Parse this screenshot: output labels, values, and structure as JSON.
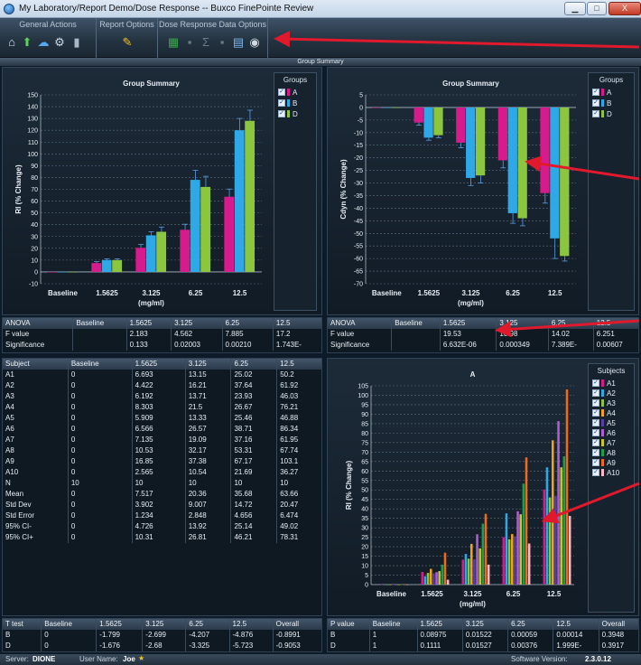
{
  "window": {
    "title": "My Laboratory/Report Demo/Dose Response -- Buxco FinePointe Review",
    "minimize": "▁",
    "maximize": "□",
    "close": "X"
  },
  "ribbon": {
    "groups": [
      {
        "label": "General Actions"
      },
      {
        "label": "Report Options"
      },
      {
        "label": "Dose Response Data Options"
      }
    ]
  },
  "panel_header": "Group Summary",
  "colors": {
    "A": "#d81b8c",
    "B": "#2ea8e6",
    "D": "#8cc63f",
    "arrow": "#e0192c"
  },
  "chart_data": [
    {
      "type": "bar",
      "title": "Group Summary",
      "xlabel": "(mg/ml)",
      "ylabel": "RI (% Change)",
      "categories": [
        "Baseline",
        "1.5625",
        "3.125",
        "6.25",
        "12.5"
      ],
      "ylim": [
        -10,
        150
      ],
      "ytick_step": 10,
      "legend_title": "Groups",
      "series": [
        {
          "name": "A",
          "values": [
            0,
            7.5,
            20.4,
            35.7,
            63.7
          ],
          "err": [
            0,
            1.2,
            2.8,
            4.7,
            6.5
          ]
        },
        {
          "name": "B",
          "values": [
            0,
            10,
            31,
            78,
            120
          ],
          "err": [
            0,
            1,
            3,
            8,
            10
          ]
        },
        {
          "name": "D",
          "values": [
            0,
            10,
            34,
            72,
            128
          ],
          "err": [
            0,
            1,
            4,
            9,
            9
          ]
        }
      ]
    },
    {
      "type": "bar",
      "title": "Group Summary",
      "xlabel": "(mg/ml)",
      "ylabel": "Cdyn (% Change)",
      "categories": [
        "Baseline",
        "1.5625",
        "3.125",
        "6.25",
        "12.5"
      ],
      "ylim": [
        -70,
        5
      ],
      "ytick_step": 5,
      "legend_title": "Groups",
      "series": [
        {
          "name": "A",
          "values": [
            0,
            -6,
            -14,
            -21,
            -34
          ],
          "err": [
            0,
            1,
            2,
            3,
            4
          ]
        },
        {
          "name": "B",
          "values": [
            0,
            -12,
            -28,
            -42,
            -52
          ],
          "err": [
            0,
            1,
            3,
            4,
            8
          ]
        },
        {
          "name": "D",
          "values": [
            0,
            -11,
            -27,
            -44,
            -59
          ],
          "err": [
            0,
            1,
            3,
            3,
            2
          ]
        }
      ]
    },
    {
      "type": "bar",
      "title": "A",
      "xlabel": "(mg/ml)",
      "ylabel": "RI (% Change)",
      "categories": [
        "Baseline",
        "1.5625",
        "3.125",
        "6.25",
        "12.5"
      ],
      "ylim": [
        0,
        105
      ],
      "ytick_step": 5,
      "legend_title": "Subjects",
      "series": [
        {
          "name": "A1",
          "values": [
            0,
            6.693,
            13.15,
            25.02,
            50.2
          ]
        },
        {
          "name": "A2",
          "values": [
            0,
            4.422,
            16.21,
            37.64,
            61.92
          ]
        },
        {
          "name": "A3",
          "values": [
            0,
            6.192,
            13.71,
            23.93,
            46.03
          ]
        },
        {
          "name": "A4",
          "values": [
            0,
            8.303,
            21.5,
            26.67,
            76.21
          ]
        },
        {
          "name": "A5",
          "values": [
            0,
            5.909,
            13.33,
            25.46,
            46.88
          ]
        },
        {
          "name": "A6",
          "values": [
            0,
            6.566,
            26.57,
            38.71,
            86.34
          ]
        },
        {
          "name": "A7",
          "values": [
            0,
            7.135,
            19.09,
            37.16,
            61.95
          ]
        },
        {
          "name": "A8",
          "values": [
            0,
            10.53,
            32.17,
            53.31,
            67.74
          ]
        },
        {
          "name": "A9",
          "values": [
            0,
            16.85,
            37.38,
            67.17,
            103.1
          ]
        },
        {
          "name": "A10",
          "values": [
            0,
            2.565,
            10.54,
            21.69,
            36.27
          ]
        }
      ],
      "colors": [
        "#d81b8c",
        "#2ea8e6",
        "#8cc63f",
        "#f0a21e",
        "#5a3ea8",
        "#ad5fd0",
        "#c4c92a",
        "#1c9f4a",
        "#f06a1c",
        "#f9b8c8"
      ]
    }
  ],
  "anova_left": {
    "headers": [
      "ANOVA",
      "Baseline",
      "1.5625",
      "3.125",
      "6.25",
      "12.5"
    ],
    "rows": [
      [
        "F value",
        "",
        "2.183",
        "4.562",
        "7.885",
        "17.2"
      ],
      [
        "Significance",
        "",
        "0.133",
        "0.02003",
        "0.00210",
        "1.743E-"
      ]
    ]
  },
  "anova_right": {
    "headers": [
      "ANOVA",
      "Baseline",
      "1.5625",
      "3.125",
      "6.25",
      "12.5"
    ],
    "rows": [
      [
        "F value",
        "",
        "19.53",
        "10.98",
        "14.02",
        "6.251"
      ],
      [
        "Significance",
        "",
        "6.632E-06",
        "0.000349",
        "7.389E-",
        "0.00607"
      ]
    ]
  },
  "subjects_table": {
    "headers": [
      "Subject",
      "Baseline",
      "1.5625",
      "3.125",
      "6.25",
      "12.5"
    ],
    "rows": [
      [
        "A1",
        "0",
        "6.693",
        "13.15",
        "25.02",
        "50.2"
      ],
      [
        "A2",
        "0",
        "4.422",
        "16.21",
        "37.64",
        "61.92"
      ],
      [
        "A3",
        "0",
        "6.192",
        "13.71",
        "23.93",
        "46.03"
      ],
      [
        "A4",
        "0",
        "8.303",
        "21.5",
        "26.67",
        "76.21"
      ],
      [
        "A5",
        "0",
        "5.909",
        "13.33",
        "25.46",
        "46.88"
      ],
      [
        "A6",
        "0",
        "6.566",
        "26.57",
        "38.71",
        "86.34"
      ],
      [
        "A7",
        "0",
        "7.135",
        "19.09",
        "37.16",
        "61.95"
      ],
      [
        "A8",
        "0",
        "10.53",
        "32.17",
        "53.31",
        "67.74"
      ],
      [
        "A9",
        "0",
        "16.85",
        "37.38",
        "67.17",
        "103.1"
      ],
      [
        "A10",
        "0",
        "2.565",
        "10.54",
        "21.69",
        "36.27"
      ],
      [
        "N",
        "10",
        "10",
        "10",
        "10",
        "10"
      ],
      [
        "Mean",
        "0",
        "7.517",
        "20.36",
        "35.68",
        "63.66"
      ],
      [
        "Std Dev",
        "0",
        "3.902",
        "9.007",
        "14.72",
        "20.47"
      ],
      [
        "Std Error",
        "0",
        "1.234",
        "2.848",
        "4.656",
        "6.474"
      ],
      [
        "95% CI-",
        "0",
        "4.726",
        "13.92",
        "25.14",
        "49.02"
      ],
      [
        "95% CI+",
        "0",
        "10.31",
        "26.81",
        "46.21",
        "78.31"
      ]
    ]
  },
  "ttest_table": {
    "headers": [
      "T test",
      "Baseline",
      "1.5625",
      "3.125",
      "6.25",
      "12.5",
      "Overall"
    ],
    "rows": [
      [
        "B",
        "0",
        "-1.799",
        "-2.699",
        "-4.207",
        "-4.876",
        "-0.8991"
      ],
      [
        "D",
        "0",
        "-1.676",
        "-2.68",
        "-3.325",
        "-5.723",
        "-0.9053"
      ]
    ]
  },
  "pvalue_table": {
    "headers": [
      "P value",
      "Baseline",
      "1.5625",
      "3.125",
      "6.25",
      "12.5",
      "Overall"
    ],
    "rows": [
      [
        "B",
        "1",
        "0.08975",
        "0.01522",
        "0.00059",
        "0.00014",
        "0.3948"
      ],
      [
        "D",
        "1",
        "0.1111",
        "0.01527",
        "0.00376",
        "1.999E-",
        "0.3917"
      ]
    ]
  },
  "status": {
    "server_label": "Server:",
    "server": "DIONE",
    "user_label": "User Name:",
    "user": "Joe",
    "version_label": "Software Version:",
    "version": "2.3.0.12"
  }
}
